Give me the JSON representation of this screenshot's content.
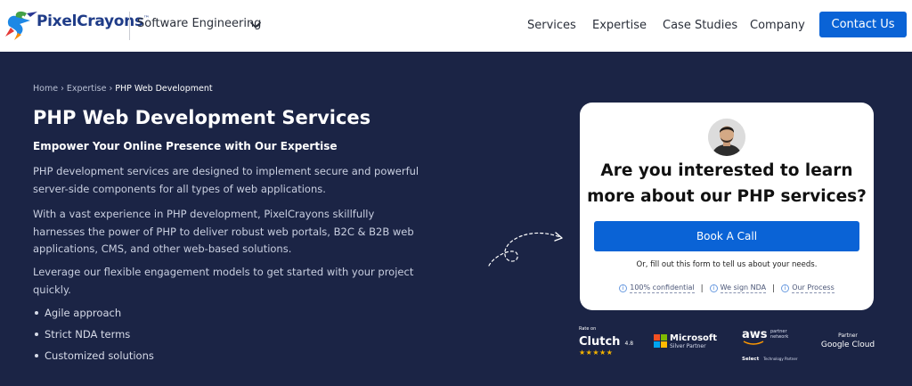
{
  "header": {
    "brand": "PixelCrayons",
    "brand_tm": "™",
    "category": "Software Engineering",
    "nav": [
      "Services",
      "Expertise",
      "Case Studies",
      "Company"
    ],
    "cta": "Contact Us",
    "cta_color": "#0a63d6"
  },
  "hero": {
    "breadcrumb": [
      "Home",
      "Expertise",
      "PHP Web Development"
    ],
    "breadcrumb_sep": "›",
    "title": "PHP Web Development Services",
    "subtitle": "Empower Your Online Presence with Our Expertise",
    "paragraphs": [
      "PHP development services are designed to implement secure and powerful server-side components for all types of web applications.",
      "With a vast experience in PHP development, PixelCrayons skillfully harnesses the power of PHP to deliver robust web portals, B2C & B2B web applications, CMS, and other web-based solutions.",
      "Leverage our flexible engagement models to get started with your project quickly."
    ],
    "bullets": [
      "Agile approach",
      "Strict NDA terms",
      "Customized solutions"
    ],
    "background_color": "#1b2445"
  },
  "card": {
    "question": "Are you interested to learn more about our PHP services?",
    "button": "Book A Call",
    "note": "Or, fill out this form to tell us about your needs.",
    "badges": [
      "100% confidential",
      "We sign NDA",
      "Our Process"
    ],
    "badge_icon": "info-icon",
    "badge_sep": "|"
  },
  "partners": {
    "clutch": {
      "rate_on": "Rate on",
      "name": "Clutch",
      "rating": "4.8",
      "stars": "★★★★★"
    },
    "microsoft": {
      "name": "Microsoft",
      "tier": "Silver Partner"
    },
    "aws": {
      "name": "aws",
      "line1": "partner",
      "line2": "network",
      "tier": "Select",
      "tier_suffix": "Technology Partner"
    },
    "google": {
      "label": "Partner",
      "name": "Google Cloud"
    }
  }
}
